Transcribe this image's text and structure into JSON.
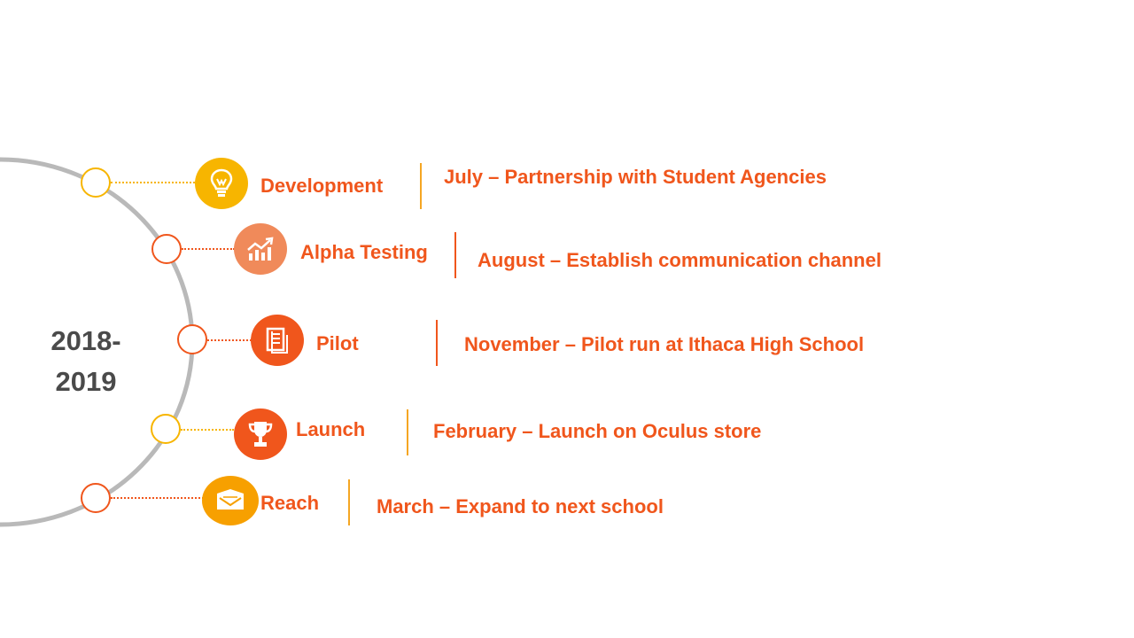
{
  "year": {
    "line1": "2018-",
    "line2": "2019"
  },
  "milestones": [
    {
      "phase": "Development",
      "icon": "lightbulb-icon",
      "detail": "July – Partnership with Student Agencies",
      "color": "#f7b500"
    },
    {
      "phase": "Alpha Testing",
      "icon": "chart-growth-icon",
      "detail": "August – Establish communication channel",
      "color": "#f08a5a"
    },
    {
      "phase": "Pilot",
      "icon": "document-icon",
      "detail": "November –  Pilot run at Ithaca High School",
      "color": "#f0561c"
    },
    {
      "phase": "Launch",
      "icon": "trophy-icon",
      "detail": "February – Launch on Oculus store",
      "color": "#f0561c"
    },
    {
      "phase": "Reach",
      "icon": "envelope-icon",
      "detail": "March – Expand to next school",
      "color": "#f7a000"
    }
  ],
  "colors": {
    "accent": "#f0561c",
    "yellow": "#f7b500",
    "arc": "#b9b9b9",
    "year": "#4a4a4a"
  }
}
